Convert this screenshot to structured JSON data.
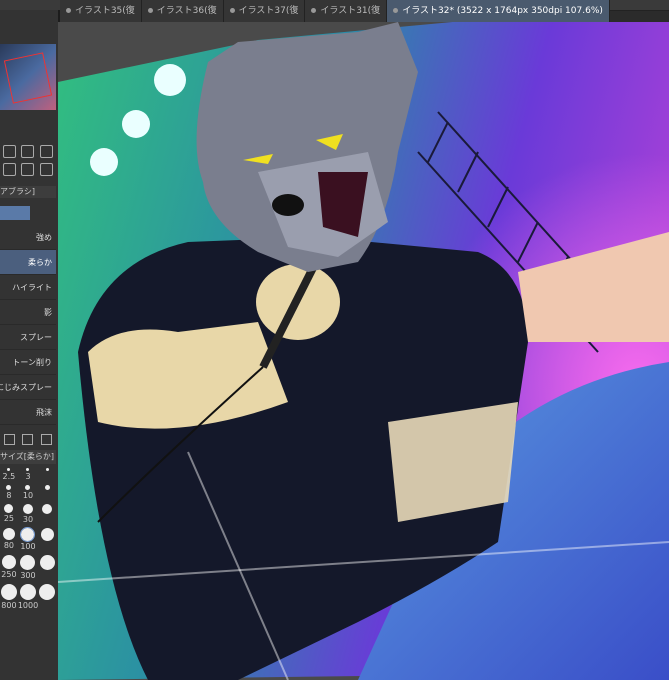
{
  "tabs": [
    {
      "label": "イラスト35(復",
      "active": false
    },
    {
      "label": "イラスト36(復",
      "active": false
    },
    {
      "label": "イラスト37(復",
      "active": false
    },
    {
      "label": "イラスト31(復",
      "active": false
    },
    {
      "label": "イラスト32* (3522 x 1764px 350dpi 107.6%)",
      "active": true
    }
  ],
  "left_panel": {
    "brush_header": "アブラシ]",
    "brush_items": [
      {
        "label": "強め",
        "selected": false
      },
      {
        "label": "柔らか",
        "selected": true
      },
      {
        "label": "ハイライト",
        "selected": false
      },
      {
        "label": "影",
        "selected": false
      },
      {
        "label": "スプレー",
        "selected": false
      },
      {
        "label": "トーン削り",
        "selected": false
      },
      {
        "label": "にじみスプレー",
        "selected": false
      },
      {
        "label": "飛沫",
        "selected": false
      }
    ],
    "size_header": "サイズ[柔らか]",
    "sizes": [
      "2.5",
      "3",
      "",
      "8",
      "10",
      "",
      "25",
      "30",
      "",
      "80",
      "100",
      "",
      "250",
      "300",
      "",
      "800",
      "1000",
      ""
    ]
  },
  "colors": {
    "accent": "#4b5f7e",
    "stage_green": "#3ec28a",
    "stage_magenta": "#d050e0",
    "stage_blue": "#3a5ed8"
  }
}
